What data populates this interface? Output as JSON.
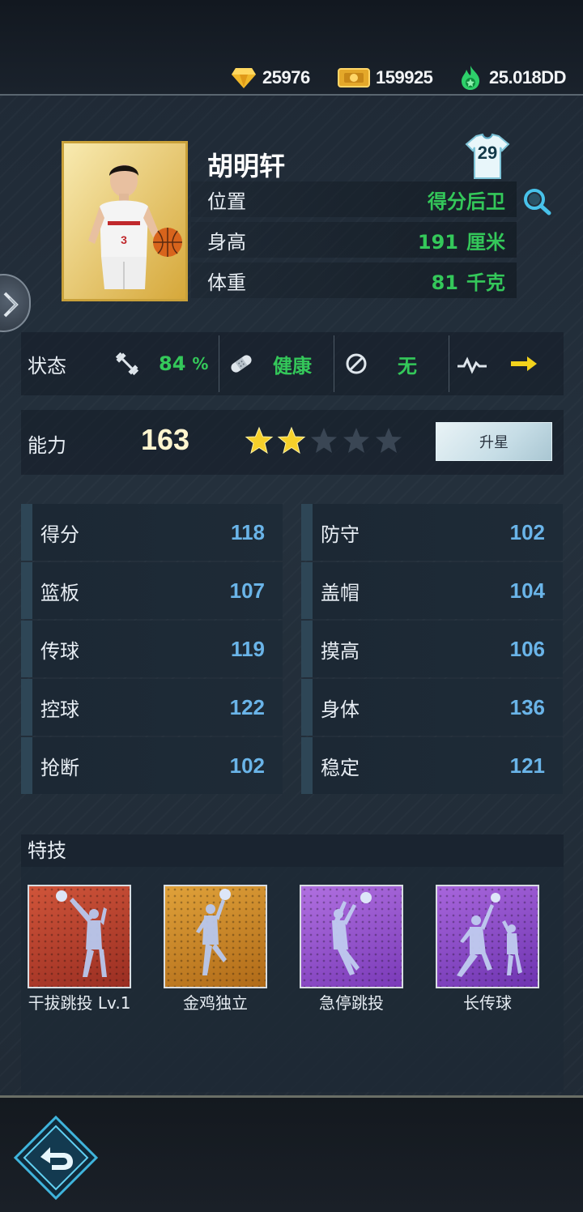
{
  "currency": {
    "diamonds": "25976",
    "gold": "159925",
    "energy": "25.018DD"
  },
  "player": {
    "name": "胡明轩",
    "jersey_number": "29",
    "position_label": "位置",
    "position_value": "得分后卫",
    "height_label": "身高",
    "height_value": "191",
    "height_unit": "厘米",
    "weight_label": "体重",
    "weight_value": "81",
    "weight_unit": "千克"
  },
  "status": {
    "label": "状态",
    "fitness_value": "84",
    "fitness_unit": "%",
    "health_value": "健康",
    "ban_value": "无"
  },
  "ability": {
    "label": "能力",
    "value": "163",
    "stars_filled": 2,
    "stars_total": 5,
    "upgrade_label": "升星"
  },
  "stats": {
    "left": [
      {
        "label": "得分",
        "value": "118"
      },
      {
        "label": "篮板",
        "value": "107"
      },
      {
        "label": "传球",
        "value": "119"
      },
      {
        "label": "控球",
        "value": "122"
      },
      {
        "label": "抢断",
        "value": "102"
      }
    ],
    "right": [
      {
        "label": "防守",
        "value": "102"
      },
      {
        "label": "盖帽",
        "value": "104"
      },
      {
        "label": "摸高",
        "value": "106"
      },
      {
        "label": "身体",
        "value": "136"
      },
      {
        "label": "稳定",
        "value": "121"
      }
    ]
  },
  "skills": {
    "title": "特技",
    "items": [
      {
        "name": "干拔跳投 Lv.1",
        "color": "#b8402c"
      },
      {
        "name": "金鸡独立",
        "color": "#d08a2a"
      },
      {
        "name": "急停跳投",
        "color": "#9050c8"
      },
      {
        "name": "长传球",
        "color": "#8a46c4"
      }
    ]
  },
  "colors": {
    "accent_green": "#34c85a",
    "stat_blue": "#6ab4e8",
    "arrow_yellow": "#f2d21c"
  }
}
